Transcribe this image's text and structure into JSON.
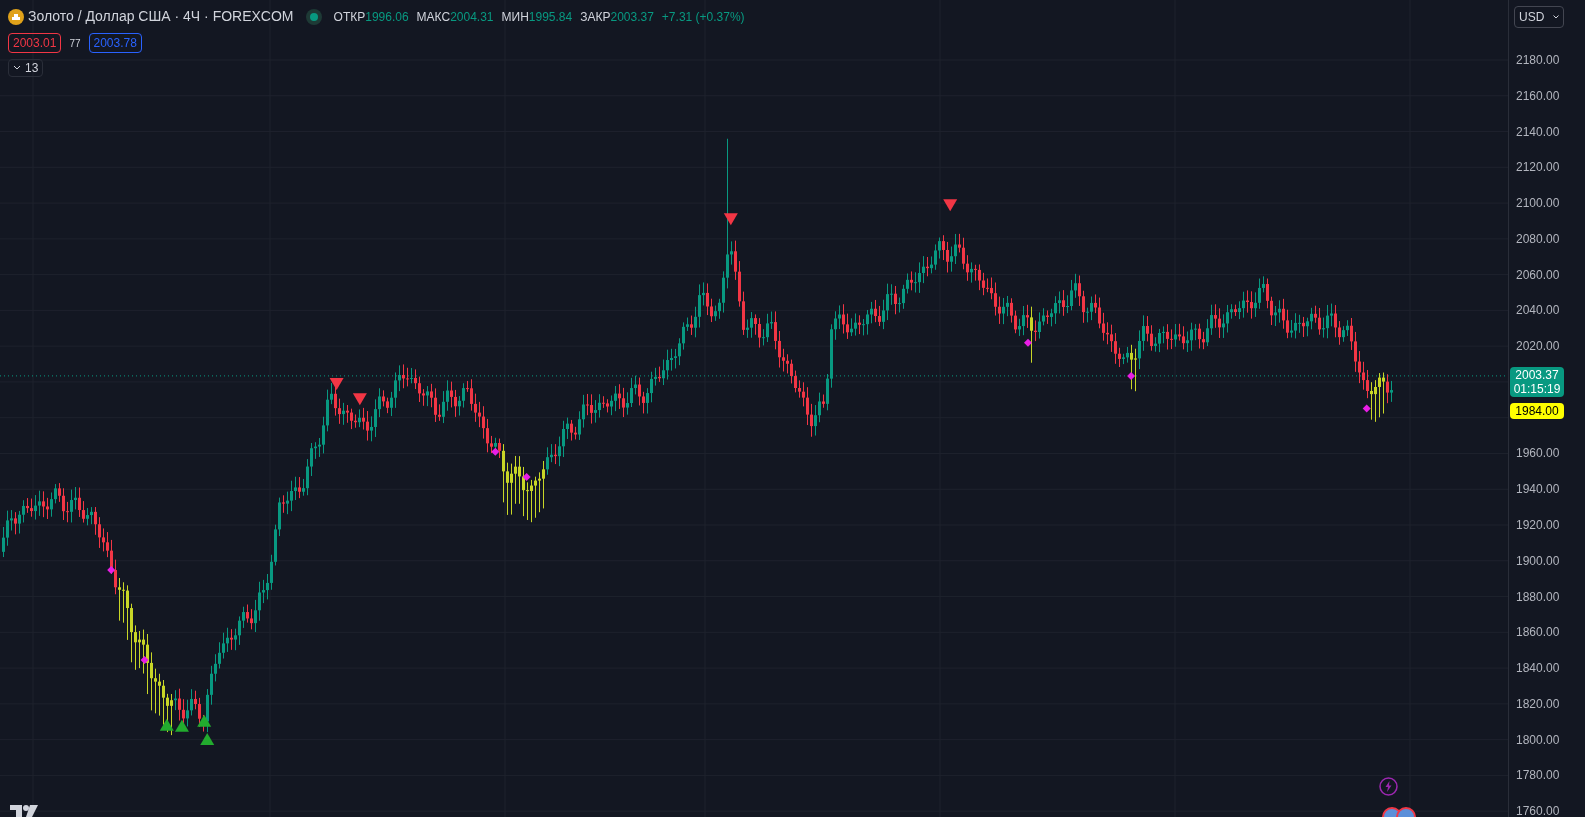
{
  "symbol": {
    "title": "Золото / Доллар США · 4Ч · FOREXCOM",
    "market_open": true
  },
  "ohlc": [
    {
      "label": "ОТКР",
      "value": "1996.06"
    },
    {
      "label": "МАКС",
      "value": "2004.31"
    },
    {
      "label": "МИН",
      "value": "1995.84"
    },
    {
      "label": "ЗАКР",
      "value": "2003.37"
    }
  ],
  "change": "+7.31 (+0.37%)",
  "quote": {
    "bid": "2003.01",
    "spread": "77",
    "ask": "2003.78"
  },
  "indicators": {
    "count": "13"
  },
  "currency": "USD",
  "price_axis": [
    "2180.00",
    "2160.00",
    "2140.00",
    "2120.00",
    "2100.00",
    "2080.00",
    "2060.00",
    "2040.00",
    "2020.00",
    "1960.00",
    "1940.00",
    "1920.00",
    "1900.00",
    "1880.00",
    "1860.00",
    "1840.00",
    "1820.00",
    "1800.00",
    "1780.00",
    "1760.00"
  ],
  "last_price": {
    "price": "2003.37",
    "countdown": "01:15:19"
  },
  "alert_price": "1984.00"
}
